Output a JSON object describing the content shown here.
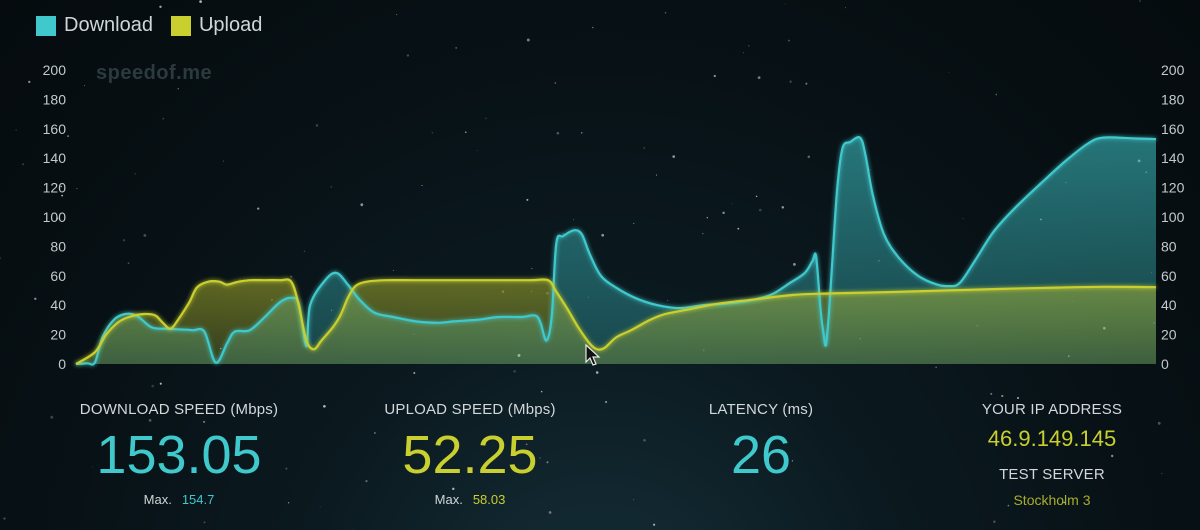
{
  "legend": {
    "download": "Download",
    "upload": "Upload"
  },
  "watermark": "speedof.me",
  "colors": {
    "download": "#3fc9cc",
    "upload": "#c9cf2e",
    "background": "#071014"
  },
  "chart_data": {
    "type": "area",
    "ylim": [
      0,
      200
    ],
    "yticks": [
      0,
      20,
      40,
      60,
      80,
      100,
      120,
      140,
      160,
      180,
      200
    ],
    "grid": false,
    "legend_position": "top-left",
    "series": [
      {
        "name": "Download",
        "points": [
          [
            0,
            0
          ],
          [
            1.5,
            0.5
          ],
          [
            2.5,
            1
          ],
          [
            3.5,
            18
          ],
          [
            5,
            30
          ],
          [
            6.5,
            34
          ],
          [
            8,
            33
          ],
          [
            10,
            25
          ],
          [
            12,
            24
          ],
          [
            14,
            23.5
          ],
          [
            15.5,
            23
          ],
          [
            17,
            22
          ],
          [
            18.5,
            1
          ],
          [
            20,
            14
          ],
          [
            21,
            22
          ],
          [
            23,
            23
          ],
          [
            25,
            32
          ],
          [
            27,
            42
          ],
          [
            28.5,
            45
          ],
          [
            29.5,
            41
          ],
          [
            30.5,
            12
          ],
          [
            31,
            40
          ],
          [
            33,
            57
          ],
          [
            34.5,
            62
          ],
          [
            36,
            54
          ],
          [
            37.5,
            44
          ],
          [
            39.5,
            35
          ],
          [
            42,
            32
          ],
          [
            45,
            29
          ],
          [
            48,
            28
          ],
          [
            50,
            29
          ],
          [
            53,
            30
          ],
          [
            56,
            32
          ],
          [
            59,
            32
          ],
          [
            60.8,
            33
          ],
          [
            61.5,
            28
          ],
          [
            62.3,
            16
          ],
          [
            63,
            33
          ],
          [
            63.6,
            82
          ],
          [
            64.5,
            87
          ],
          [
            66,
            91
          ],
          [
            67,
            88
          ],
          [
            68,
            75
          ],
          [
            69.5,
            60
          ],
          [
            71.5,
            52
          ],
          [
            74,
            45
          ],
          [
            77,
            40
          ],
          [
            80,
            38
          ],
          [
            83,
            40
          ],
          [
            86,
            41
          ],
          [
            89,
            43
          ],
          [
            92,
            47
          ],
          [
            94.5,
            55
          ],
          [
            96.5,
            62
          ],
          [
            97.5,
            70
          ],
          [
            98,
            73
          ],
          [
            98.6,
            36
          ],
          [
            99,
            20
          ],
          [
            99.3,
            13
          ],
          [
            99.7,
            35
          ],
          [
            100.2,
            75
          ],
          [
            100.8,
            120
          ],
          [
            101.5,
            147
          ],
          [
            102.5,
            151
          ],
          [
            103.8,
            154
          ],
          [
            104.5,
            143
          ],
          [
            105.5,
            115
          ],
          [
            107,
            88
          ],
          [
            109,
            72
          ],
          [
            111.5,
            60
          ],
          [
            114,
            54
          ],
          [
            115.5,
            53
          ],
          [
            117,
            55
          ],
          [
            119,
            70
          ],
          [
            121.5,
            90
          ],
          [
            124.5,
            107
          ],
          [
            128,
            124
          ],
          [
            131,
            138
          ],
          [
            134,
            150
          ],
          [
            136,
            154
          ],
          [
            140,
            153.5
          ],
          [
            143,
            153
          ]
        ]
      },
      {
        "name": "Upload",
        "points": [
          [
            0,
            0
          ],
          [
            2.5,
            8
          ],
          [
            4,
            20
          ],
          [
            5.5,
            28
          ],
          [
            7,
            32
          ],
          [
            9,
            34
          ],
          [
            10.5,
            33
          ],
          [
            11.5,
            28
          ],
          [
            12.5,
            24
          ],
          [
            13.5,
            30
          ],
          [
            15,
            42
          ],
          [
            16,
            52
          ],
          [
            17.5,
            56
          ],
          [
            19,
            56
          ],
          [
            20,
            54
          ],
          [
            21.5,
            56
          ],
          [
            23,
            57
          ],
          [
            25,
            57
          ],
          [
            27,
            57
          ],
          [
            28.5,
            56
          ],
          [
            29.5,
            40
          ],
          [
            30.5,
            16
          ],
          [
            31.5,
            10
          ],
          [
            32.5,
            16
          ],
          [
            34,
            25
          ],
          [
            35,
            33
          ],
          [
            36,
            45
          ],
          [
            37,
            53
          ],
          [
            38.5,
            56
          ],
          [
            41,
            57
          ],
          [
            45,
            57
          ],
          [
            50,
            57
          ],
          [
            55,
            57
          ],
          [
            60,
            57
          ],
          [
            62.5,
            57
          ],
          [
            63.5,
            50
          ],
          [
            65,
            38
          ],
          [
            66.5,
            25
          ],
          [
            68,
            14
          ],
          [
            69,
            10
          ],
          [
            70,
            11
          ],
          [
            71.5,
            18
          ],
          [
            73.5,
            23
          ],
          [
            76,
            30
          ],
          [
            78,
            34
          ],
          [
            81,
            37
          ],
          [
            85,
            41
          ],
          [
            90,
            44
          ],
          [
            95,
            47
          ],
          [
            100,
            48
          ],
          [
            108,
            49
          ],
          [
            115,
            50
          ],
          [
            122,
            51
          ],
          [
            130,
            52
          ],
          [
            136,
            52.5
          ],
          [
            143,
            52.25
          ]
        ]
      }
    ]
  },
  "stats": {
    "download": {
      "label": "DOWNLOAD SPEED (Mbps)",
      "value": "153.05",
      "max_label": "Max.",
      "max_value": "154.7"
    },
    "upload": {
      "label": "UPLOAD SPEED (Mbps)",
      "value": "52.25",
      "max_label": "Max.",
      "max_value": "58.03"
    },
    "latency": {
      "label": "LATENCY (ms)",
      "value": "26"
    },
    "ip": {
      "label": "YOUR IP ADDRESS",
      "value": "46.9.149.145"
    },
    "server": {
      "label": "TEST SERVER",
      "value": "Stockholm 3"
    }
  }
}
